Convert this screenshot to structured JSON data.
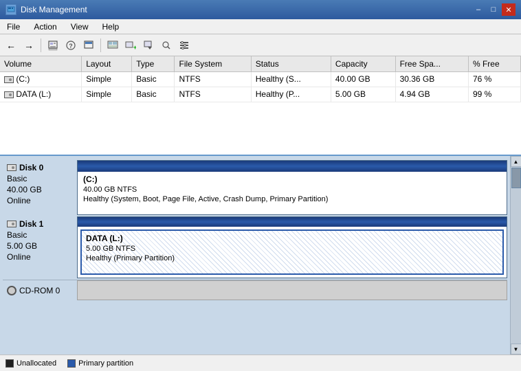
{
  "titlebar": {
    "title": "Disk Management",
    "minimize_label": "–",
    "maximize_label": "□",
    "close_label": "✕"
  },
  "menubar": {
    "items": [
      "File",
      "Action",
      "View",
      "Help"
    ]
  },
  "toolbar": {
    "buttons": [
      "←",
      "→",
      "⊞",
      "?",
      "⊟",
      "📋",
      "📄",
      "📁",
      "🔍",
      "⚙"
    ]
  },
  "table": {
    "columns": [
      "Volume",
      "Layout",
      "Type",
      "File System",
      "Status",
      "Capacity",
      "Free Spa...",
      "% Free"
    ],
    "rows": [
      {
        "volume": "(C:)",
        "layout": "Simple",
        "type": "Basic",
        "filesystem": "NTFS",
        "status": "Healthy (S...",
        "capacity": "40.00 GB",
        "free": "30.36 GB",
        "percent": "76 %"
      },
      {
        "volume": "DATA (L:)",
        "layout": "Simple",
        "type": "Basic",
        "filesystem": "NTFS",
        "status": "Healthy (P...",
        "capacity": "5.00 GB",
        "free": "4.94 GB",
        "percent": "99 %"
      }
    ]
  },
  "disks": {
    "disk0": {
      "name": "Disk 0",
      "type": "Basic",
      "size": "40.00 GB",
      "status": "Online",
      "partition_title": "(C:)",
      "partition_size": "40.00 GB NTFS",
      "partition_status": "Healthy (System, Boot, Page File, Active, Crash Dump, Primary Partition)"
    },
    "disk1": {
      "name": "Disk 1",
      "type": "Basic",
      "size": "5.00 GB",
      "status": "Online",
      "partition_title": "DATA  (L:)",
      "partition_size": "5.00 GB NTFS",
      "partition_status": "Healthy (Primary Partition)"
    },
    "cdrom0": {
      "name": "CD-ROM 0"
    }
  },
  "legend": {
    "unallocated_label": "Unallocated",
    "primary_label": "Primary partition"
  }
}
